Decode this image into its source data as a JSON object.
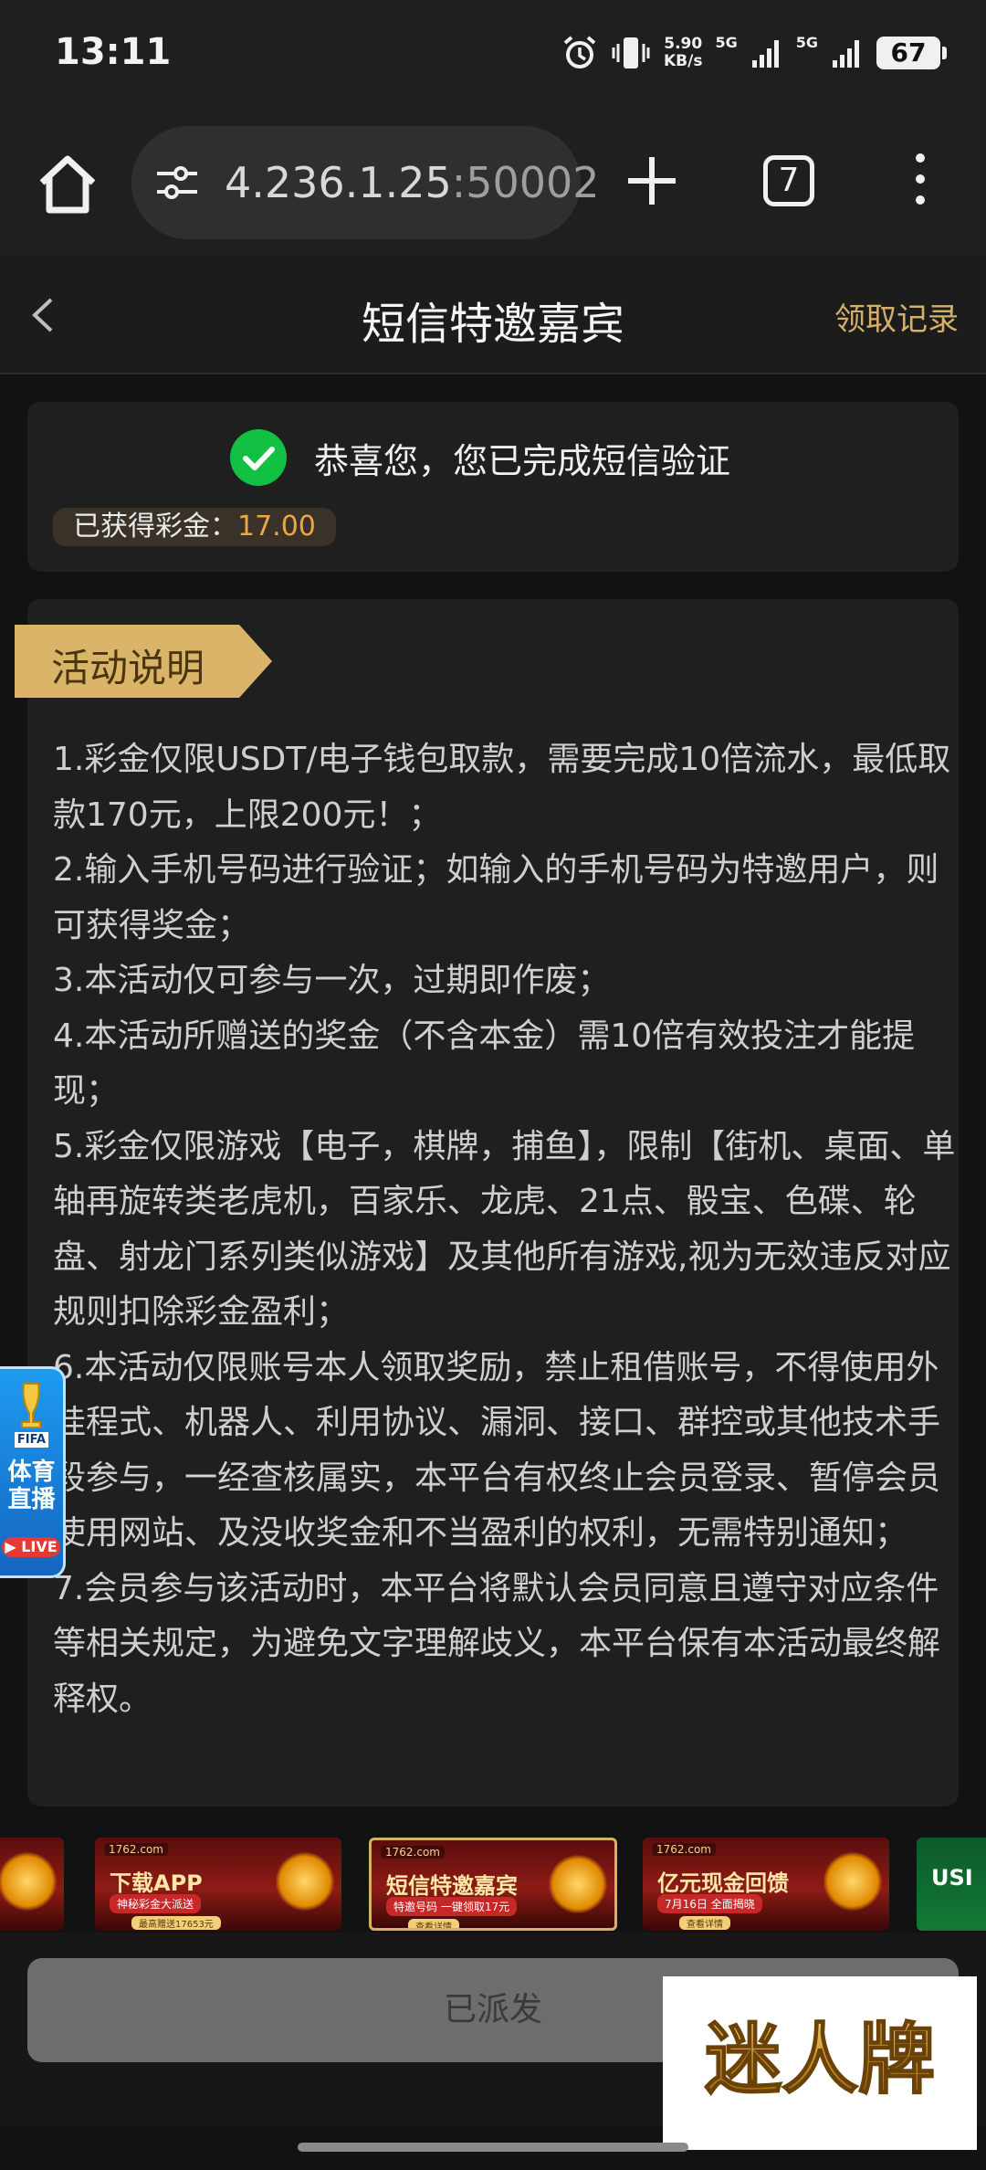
{
  "status_bar": {
    "time": "13:11",
    "net_speed_value": "5.90",
    "net_speed_unit": "KB/s",
    "signal_1": "5G",
    "signal_2": "5G",
    "battery": "67",
    "icons": [
      "alarm-icon",
      "vibrate-icon",
      "signal-icon",
      "signal-icon"
    ]
  },
  "browser": {
    "url_host": "4.236.1.25",
    "url_port": ":50002",
    "tab_count": "7",
    "icons": [
      "home-icon",
      "tune-icon",
      "plus-icon",
      "tabs-icon",
      "more-vert-icon"
    ]
  },
  "header": {
    "title": "短信特邀嘉宾",
    "right_link": "领取记录",
    "back_icon": "chevron-left-icon"
  },
  "success": {
    "message": "恭喜您，您已完成短信验证",
    "bonus_label": "已获得彩金：",
    "bonus_amount": "17.00",
    "icon": "check-circle-icon"
  },
  "rules": {
    "title": "活动说明",
    "items": [
      "1.彩金仅限USDT/电子钱包取款，需要完成10倍流水，最低取款170元，上限200元！；",
      "2.输入手机号码进行验证；如输入的手机号码为特邀用户，则可获得奖金；",
      "3.本活动仅可参与一次，过期即作废；",
      "4.本活动所赠送的奖金（不含本金）需10倍有效投注才能提现；",
      "5.彩金仅限游戏【电子，棋牌，捕鱼】，限制【街机、桌面、单轴再旋转类老虎机，百家乐、龙虎、21点、骰宝、色碟、轮盘、射龙门系列类似游戏】及其他所有游戏,视为无效违反对应规则扣除彩金盈利；",
      "6.本活动仅限账号本人领取奖励，禁止租借账号，不得使用外挂程式、机器人、利用协议、漏洞、接口、群控或其他技术手段参与，一经查核属实，本平台有权终止会员登录、暂停会员使用网站、及没收奖金和不当盈利的权利，无需特别通知；",
      "7.会员参与该活动时，本平台将默认会员同意且遵守对应条件等相关规定，为避免文字理解歧义，本平台保有本活动最终解释权。"
    ]
  },
  "floating_badge": {
    "org": "FIFA",
    "line1": "体育",
    "line2": "直播",
    "live": "LIVE",
    "icon": "trophy-icon"
  },
  "banners": [
    {
      "brand": "",
      "line1": "",
      "line2": "",
      "line3": ""
    },
    {
      "brand": "1762.com",
      "line1": "下载APP",
      "line2": "神秘彩金大派送",
      "line3": "最高赠送17653元"
    },
    {
      "brand": "1762.com",
      "line1": "短信特邀嘉宾",
      "line2": "特邀号码 一键领取17元",
      "line3": "查看详情"
    },
    {
      "brand": "1762.com",
      "line1": "亿元现金回馈",
      "line2": "7月16日 全面揭晓",
      "line3": "查看详情"
    },
    {
      "brand": "",
      "line1": "USI",
      "line2": "",
      "line3": ""
    }
  ],
  "bottom": {
    "button_label": "已派发",
    "watermark": "迷人牌"
  },
  "colors": {
    "accent_gold": "#d4b06a",
    "bonus_orange": "#e8a945",
    "success_green": "#12c144",
    "background": "#121212",
    "card": "#1f1f1f"
  }
}
